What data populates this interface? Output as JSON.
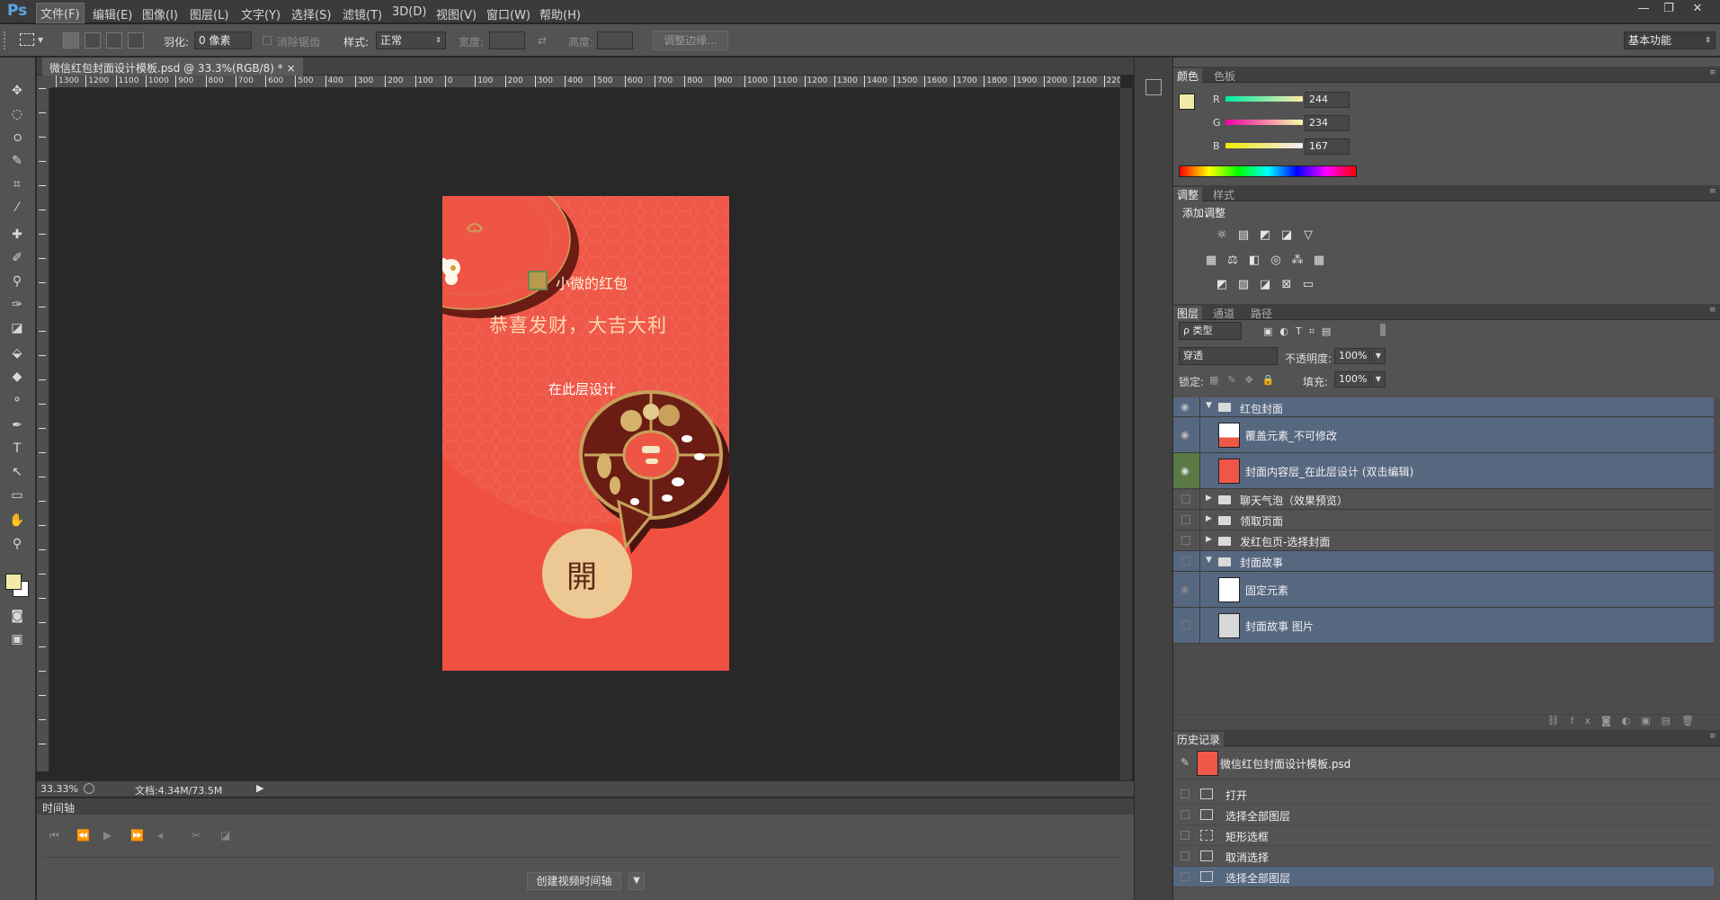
{
  "app": {
    "logo": "Ps"
  },
  "menu": [
    "文件(F)",
    "编辑(E)",
    "图像(I)",
    "图层(L)",
    "文字(Y)",
    "选择(S)",
    "滤镜(T)",
    "3D(D)",
    "视图(V)",
    "窗口(W)",
    "帮助(H)"
  ],
  "window_controls": {
    "minimize": "—",
    "restore": "❐",
    "close": "✕"
  },
  "options": {
    "feather_label": "羽化:",
    "feather_value": "0 像素",
    "antialias_label": "消除锯齿",
    "style_label": "样式:",
    "style_value": "正常",
    "width_label": "宽度:",
    "height_label": "高度:",
    "refine_edge": "调整边缘...",
    "workspace": "基本功能"
  },
  "document": {
    "tab_title": "微信红包封面设计模板.psd @ 33.3%(RGB/8) *",
    "close": "×",
    "ruler_h": [
      "1300",
      "1200",
      "1100",
      "1000",
      "900",
      "800",
      "700",
      "600",
      "500",
      "400",
      "300",
      "200",
      "100",
      "0",
      "100",
      "200",
      "300",
      "400",
      "500",
      "600",
      "700",
      "800",
      "900",
      "1000",
      "1100",
      "1200",
      "1300",
      "1400",
      "1500",
      "1600",
      "1700",
      "1800",
      "1900",
      "2000",
      "2100",
      "220"
    ],
    "zoom": "33.33%",
    "doc_size": "文档:4.34M/73.5M"
  },
  "envelope": {
    "brand": "小微的红包",
    "greeting": "恭喜发财，大吉大利",
    "design_here": "在此层设计",
    "open_char": "開"
  },
  "timeline": {
    "title": "时间轴",
    "create_button": "创建视频时间轴"
  },
  "color_panel": {
    "tabs": [
      "颜色",
      "色板"
    ],
    "labels": [
      "R",
      "G",
      "B"
    ],
    "r": "244",
    "g": "234",
    "b": "167",
    "foreground": "#f4eaa7"
  },
  "adjustments_panel": {
    "tabs": [
      "调整",
      "样式"
    ],
    "heading": "添加调整"
  },
  "layers_panel": {
    "tabs": [
      "图层",
      "通道",
      "路径"
    ],
    "filter_type": "ρ 类型",
    "blend_mode": "穿透",
    "opacity_label": "不透明度:",
    "opacity_value": "100%",
    "lock_label": "锁定:",
    "fill_label": "填充:",
    "fill_value": "100%",
    "layers": [
      {
        "name": "红包封面",
        "kind": "group-open"
      },
      {
        "name": "覆盖元素_不可修改",
        "kind": "layer"
      },
      {
        "name": "封面内容层_在此层设计 (双击编辑)",
        "kind": "layer"
      },
      {
        "name": "聊天气泡（效果预览）",
        "kind": "group-closed"
      },
      {
        "name": "领取页面",
        "kind": "group-closed"
      },
      {
        "name": "发红包页-选择封面",
        "kind": "group-closed"
      },
      {
        "name": "封面故事",
        "kind": "group-open"
      },
      {
        "name": "固定元素",
        "kind": "layer"
      },
      {
        "name": "封面故事 图片",
        "kind": "layer"
      }
    ]
  },
  "history_panel": {
    "tab": "历史记录",
    "snapshot": "微信红包封面设计模板.psd",
    "items": [
      "打开",
      "选择全部图层",
      "矩形选框",
      "取消选择",
      "选择全部图层"
    ]
  },
  "colors": {
    "accent_red": "#ef5848",
    "gold": "#c9a15a",
    "cream": "#e9cf98",
    "layer_selected": "#566780"
  }
}
